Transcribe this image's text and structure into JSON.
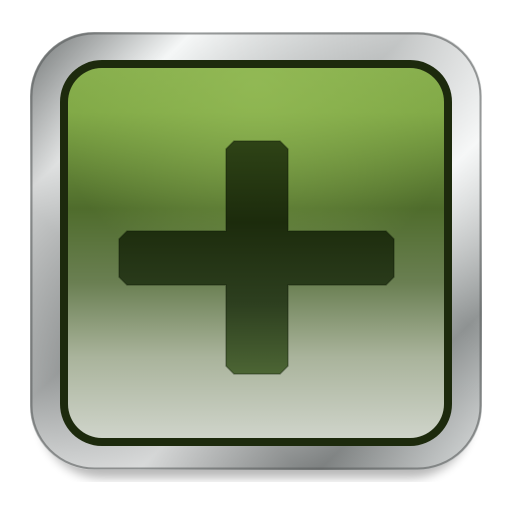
{
  "button": {
    "icon": "plus-icon",
    "action": "add"
  },
  "colors": {
    "bezel_light": "#f4f6f6",
    "bezel_mid": "#b9bcbc",
    "bezel_dark": "#4f5252",
    "inner_rim": "#1d2a0d",
    "face_top": "#86ad4c",
    "face_mid": "#4d6a2a",
    "face_bottom": "#c9cfc4",
    "glyph_dark": "#1c2b0c",
    "glyph_light": "#4c6534"
  }
}
